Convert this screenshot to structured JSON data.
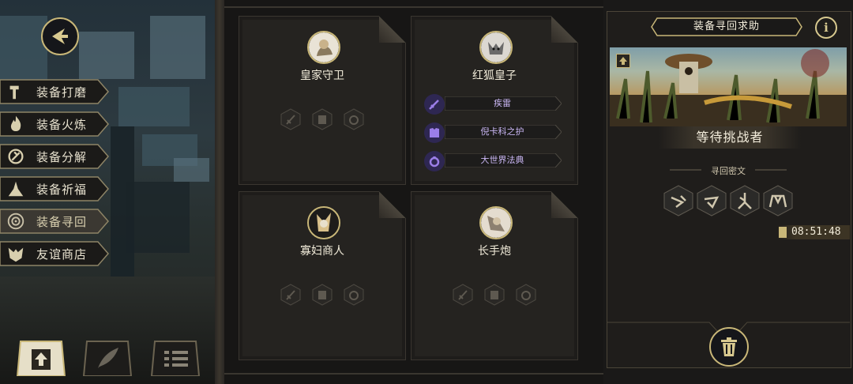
{
  "menu": {
    "items": [
      {
        "label": "装备打磨",
        "icon": "hammer-icon"
      },
      {
        "label": "装备火炼",
        "icon": "flame-icon"
      },
      {
        "label": "装备分解",
        "icon": "disassemble-icon"
      },
      {
        "label": "装备祈福",
        "icon": "prayer-icon"
      },
      {
        "label": "装备寻回",
        "icon": "spiral-icon",
        "active": true
      },
      {
        "label": "友谊商店",
        "icon": "fox-icon"
      }
    ]
  },
  "bottom_tabs": [
    {
      "icon": "upload-icon",
      "active": true
    },
    {
      "icon": "feather-icon"
    },
    {
      "icon": "list-icon"
    }
  ],
  "cards": [
    {
      "name": "皇家守卫",
      "avatar": "royal-guard-avatar",
      "equipment": []
    },
    {
      "name": "红狐皇子",
      "avatar": "red-fox-prince-avatar",
      "equipment": [
        {
          "name": "疾雷",
          "icon": "sword-icon"
        },
        {
          "name": "倪卡科之护",
          "icon": "armor-icon"
        },
        {
          "name": "大世界法典",
          "icon": "ring-icon"
        }
      ]
    },
    {
      "name": "寡妇商人",
      "avatar": "widow-merchant-avatar",
      "equipment": []
    },
    {
      "name": "长手炮",
      "avatar": "long-arm-cannon-avatar",
      "equipment": []
    }
  ],
  "right_panel": {
    "title": "装备寻回求助",
    "info_icon": "i",
    "status": "等待挑战者",
    "cipher_title": "寻回密文",
    "cipher_icons": [
      "rune-1-icon",
      "rune-2-icon",
      "rune-3-icon",
      "rune-4-icon"
    ],
    "timer": "08:51:48"
  },
  "colors": {
    "gold": "#c9b778",
    "purple_text": "#c9b6f3",
    "panel": "#252320"
  }
}
